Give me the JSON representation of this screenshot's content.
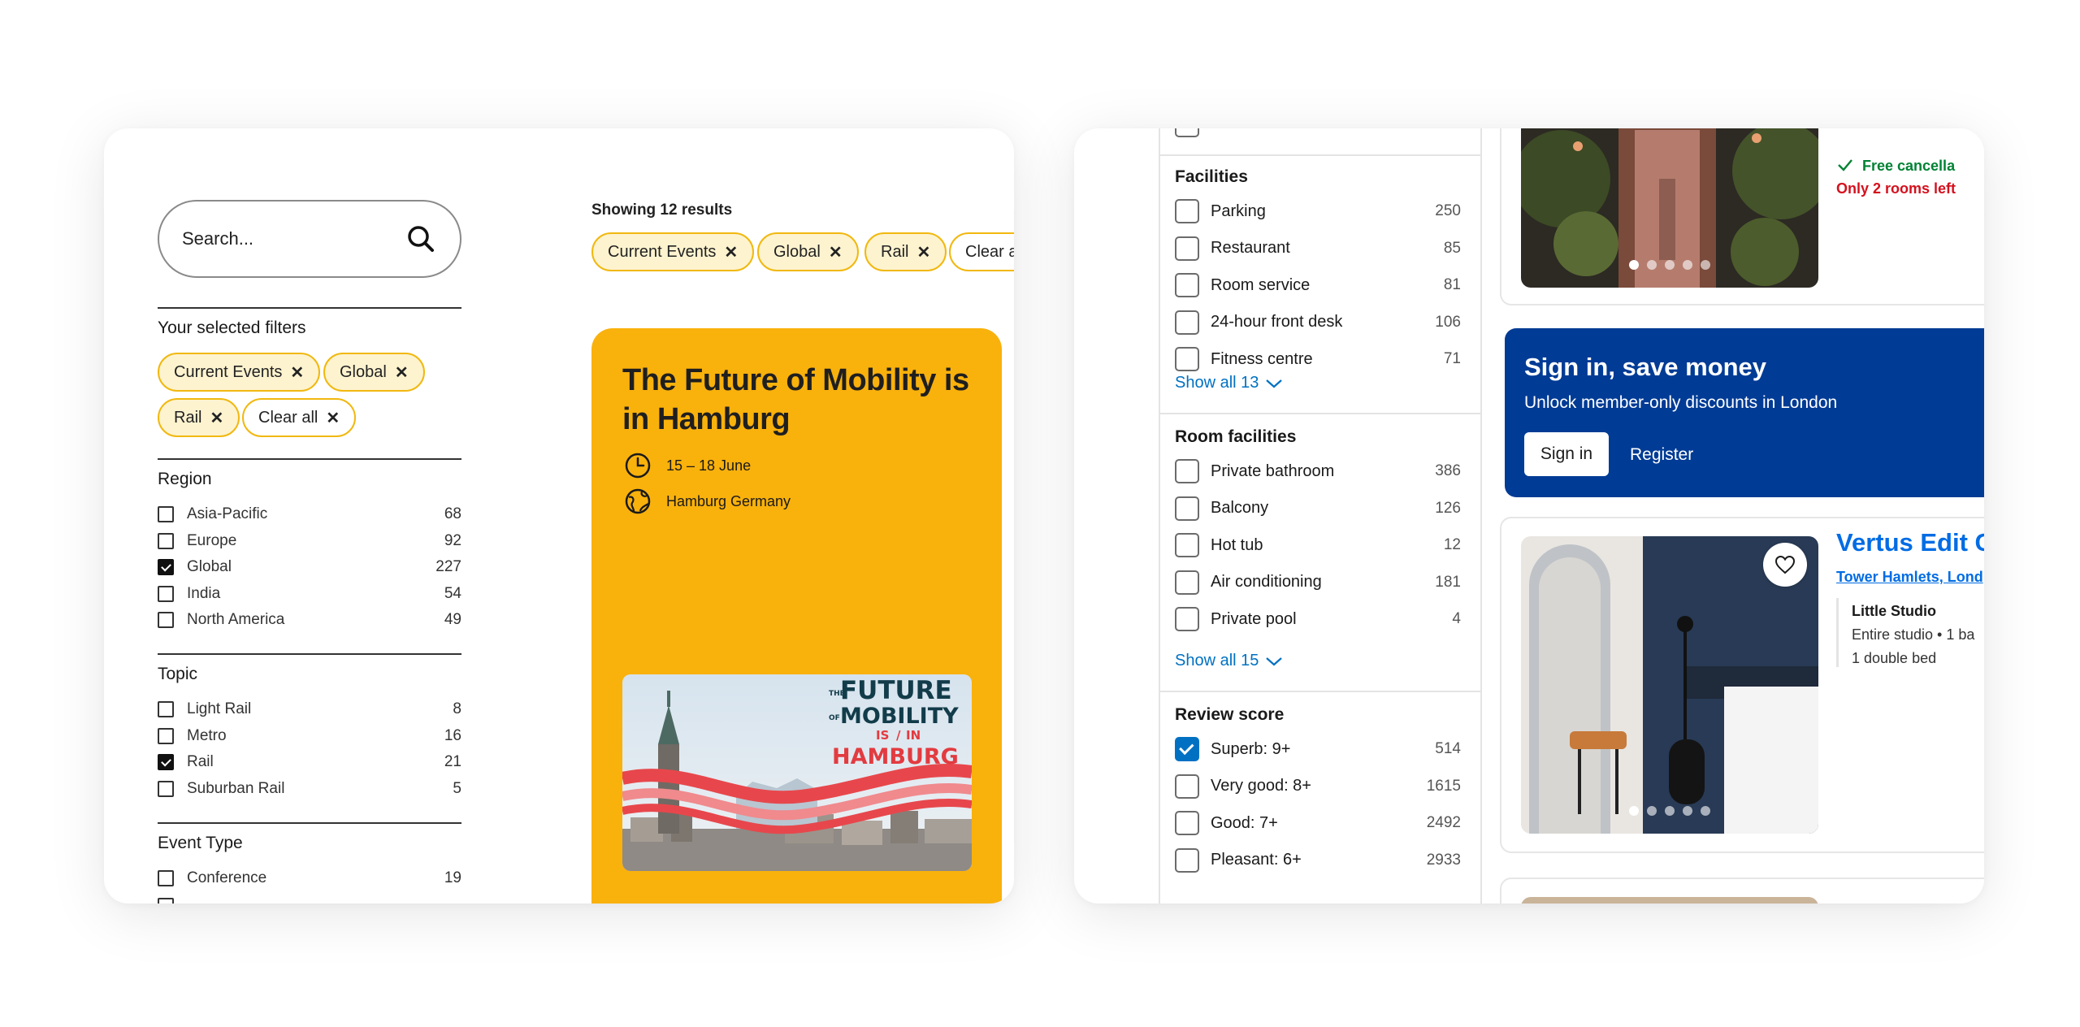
{
  "left": {
    "search_placeholder": "Search...",
    "selected_filters_heading": "Your selected filters",
    "selected_chips": [
      "Current Events",
      "Global",
      "Rail",
      "Clear all"
    ],
    "region": {
      "heading": "Region",
      "items": [
        {
          "label": "Asia-Pacific",
          "count": "68",
          "checked": false
        },
        {
          "label": "Europe",
          "count": "92",
          "checked": false
        },
        {
          "label": "Global",
          "count": "227",
          "checked": true
        },
        {
          "label": "India",
          "count": "54",
          "checked": false
        },
        {
          "label": "North America",
          "count": "49",
          "checked": false
        }
      ]
    },
    "topic": {
      "heading": "Topic",
      "items": [
        {
          "label": "Light Rail",
          "count": "8",
          "checked": false
        },
        {
          "label": "Metro",
          "count": "16",
          "checked": false
        },
        {
          "label": "Rail",
          "count": "21",
          "checked": true
        },
        {
          "label": "Suburban Rail",
          "count": "5",
          "checked": false
        }
      ]
    },
    "event_type": {
      "heading": "Event Type",
      "items": [
        {
          "label": "Conference",
          "count": "19",
          "checked": false
        }
      ]
    },
    "results_text": "Showing 12 results",
    "result_chips": [
      "Current Events",
      "Global",
      "Rail",
      "Clear a"
    ],
    "event": {
      "title": "The Future of Mobility is in Hamburg",
      "date": "15 – 18 June",
      "location": "Hamburg Germany",
      "poster_lines": [
        "THE",
        "FUTURE",
        "OF",
        "MOBILITY",
        "IS",
        "/",
        "IN",
        "HAMBURG"
      ]
    },
    "colors": {
      "accent": "#f9b10c",
      "chip_border": "#f1b80f",
      "chip_fill": "#fdf3cf"
    }
  },
  "right": {
    "facilities": {
      "heading": "Facilities",
      "items": [
        {
          "label": "Parking",
          "count": "250",
          "checked": false
        },
        {
          "label": "Restaurant",
          "count": "85",
          "checked": false
        },
        {
          "label": "Room service",
          "count": "81",
          "checked": false
        },
        {
          "label": "24-hour front desk",
          "count": "106",
          "checked": false
        },
        {
          "label": "Fitness centre",
          "count": "71",
          "checked": false
        }
      ],
      "show_all": "Show all 13"
    },
    "room_facilities": {
      "heading": "Room facilities",
      "items": [
        {
          "label": "Private bathroom",
          "count": "386",
          "checked": false
        },
        {
          "label": "Balcony",
          "count": "126",
          "checked": false
        },
        {
          "label": "Hot tub",
          "count": "12",
          "checked": false
        },
        {
          "label": "Air conditioning",
          "count": "181",
          "checked": false
        },
        {
          "label": "Private pool",
          "count": "4",
          "checked": false
        }
      ],
      "show_all": "Show all 15"
    },
    "review_score": {
      "heading": "Review score",
      "items": [
        {
          "label": "Superb: 9+",
          "count": "514",
          "checked": true
        },
        {
          "label": "Very good: 8+",
          "count": "1615",
          "checked": false
        },
        {
          "label": "Good: 7+",
          "count": "2492",
          "checked": false
        },
        {
          "label": "Pleasant: 6+",
          "count": "2933",
          "checked": false
        }
      ]
    },
    "top_listing": {
      "free_cancellation": "Free cancella",
      "rooms_left": "Only 2 rooms left"
    },
    "signin": {
      "title": "Sign in, save money",
      "subtitle": "Unlock member-only discounts in London",
      "signin_label": "Sign in",
      "register_label": "Register"
    },
    "hotel": {
      "name": "Vertus Edit C",
      "location": "Tower Hamlets, Lond",
      "room_type": "Little Studio",
      "detail_1": "Entire studio • 1 ba",
      "detail_2": "1 double bed"
    },
    "colors": {
      "brand_blue": "#003b95",
      "link_blue": "#006ce4",
      "checkbox_blue": "#0071c2",
      "success_green": "#008234",
      "urgent_red": "#d4111e"
    }
  }
}
